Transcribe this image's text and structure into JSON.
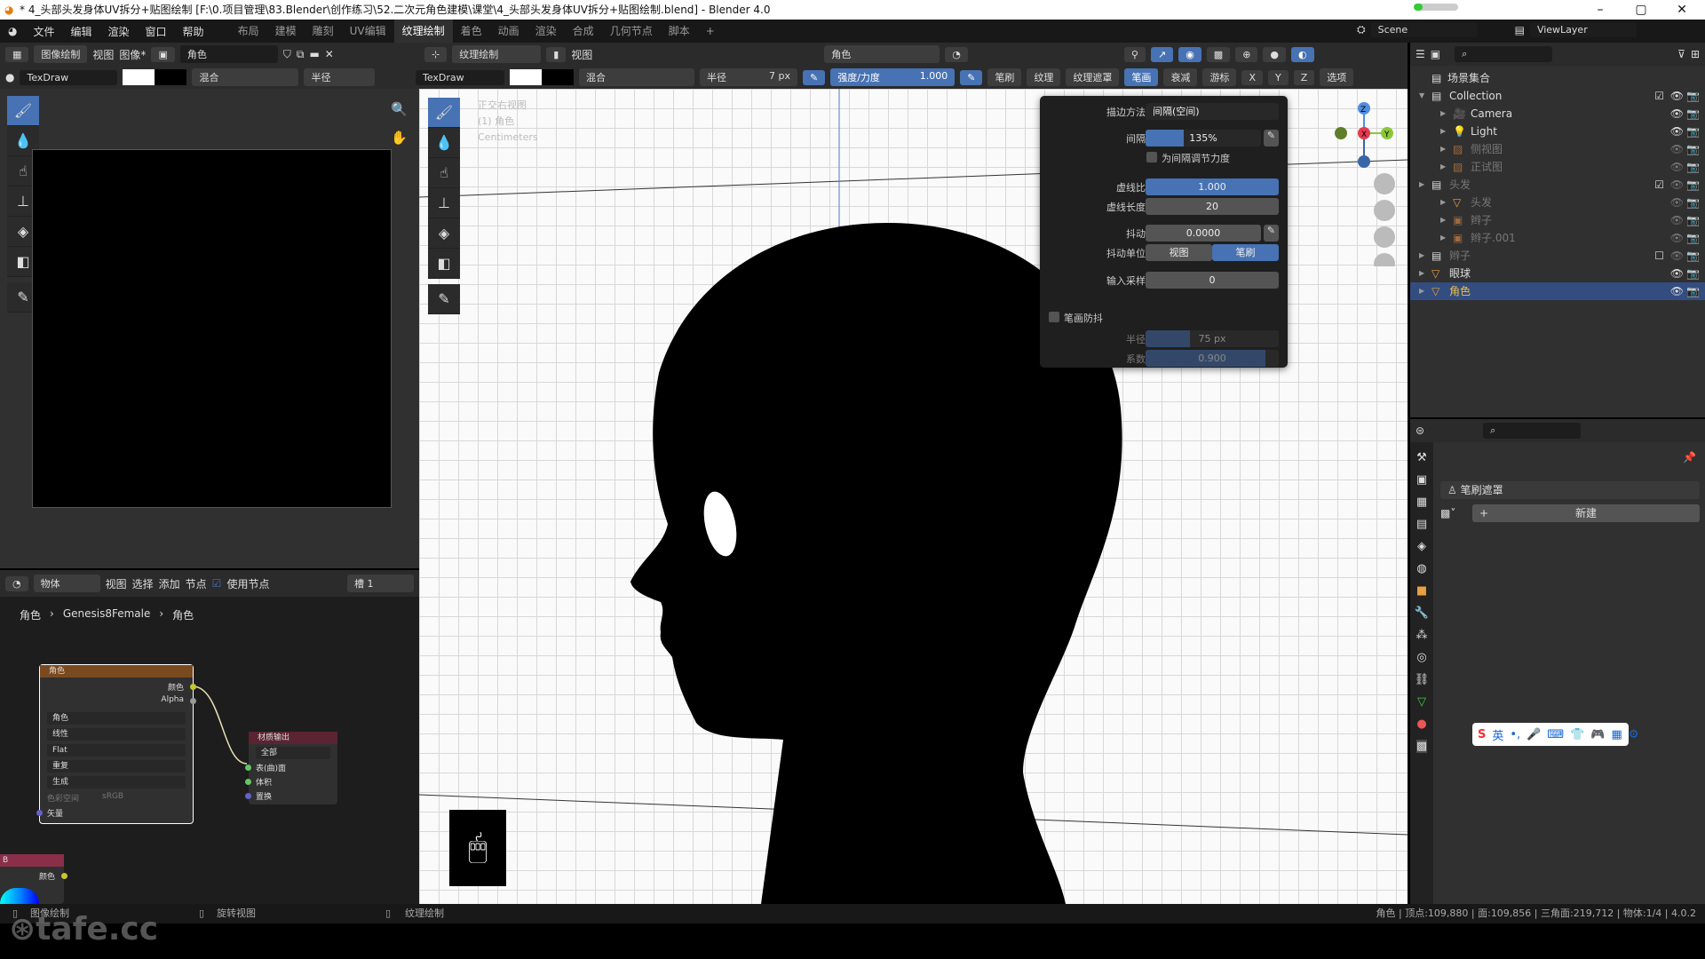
{
  "window": {
    "title": "* 4_头部头发身体UV拆分+贴图绘制 [F:\\0.项目管理\\83.Blender\\创作练习\\52.二次元角色建模\\课堂\\4_头部头发身体UV拆分+贴图绘制.blend] - Blender 4.0",
    "minimize": "–",
    "maximize": "▢",
    "close": "✕"
  },
  "menu": {
    "items": [
      "文件",
      "编辑",
      "渲染",
      "窗口",
      "帮助"
    ],
    "workspaces": [
      "布局",
      "建模",
      "雕刻",
      "UV编辑",
      "纹理绘制",
      "着色",
      "动画",
      "渲染",
      "合成",
      "几何节点",
      "脚本",
      "+"
    ],
    "active_workspace": "纹理绘制",
    "scene": "Scene",
    "view_layer": "ViewLayer"
  },
  "image_editor": {
    "mode": "图像绘制",
    "view": "视图",
    "image_menu": "图像*",
    "image_name": "角色",
    "brush": "TexDraw",
    "blend": "混合",
    "radius_label": "半径"
  },
  "viewport": {
    "mode": "纹理绘制",
    "view": "视图",
    "material": "角色",
    "brush": "TexDraw",
    "blend": "混合",
    "radius_label": "半径",
    "radius_value": "7 px",
    "strength_label": "强度/力度",
    "strength_value": "1.000",
    "menus": [
      "笔刷",
      "纹理",
      "纹理遮罩",
      "笔画",
      "衰减",
      "游标"
    ],
    "active_menu": "笔画",
    "axes": [
      "X",
      "Y",
      "Z"
    ],
    "options": "选项",
    "overlay": [
      "正交右视图",
      "(1) 角色",
      "Centimeters"
    ]
  },
  "stroke_popup": {
    "method_label": "描边方法",
    "method_value": "间隔(空间)",
    "spacing_label": "间隔",
    "spacing_value": "135%",
    "spacing_fill": 0.33,
    "spacing_pressure": "为间隔调节力度",
    "dash_ratio_label": "虚线比",
    "dash_ratio_value": "1.000",
    "dash_len_label": "虚线长度",
    "dash_len_value": "20",
    "jitter_label": "抖动",
    "jitter_value": "0.0000",
    "jitter_unit_label": "抖动单位",
    "jitter_unit_options": [
      "视图",
      "笔刷"
    ],
    "jitter_unit_selected": "笔刷",
    "input_samples_label": "输入采样",
    "input_samples_value": "0",
    "stabilize_label": "笔画防抖",
    "stab_radius_label": "半径",
    "stab_radius_value": "75 px",
    "stab_factor_label": "系数",
    "stab_factor_value": "0.900",
    "stab_factor_fill": 0.9
  },
  "node_editor": {
    "type": "物体",
    "menus": [
      "视图",
      "选择",
      "添加",
      "节点"
    ],
    "use_nodes": "使用节点",
    "slot": "槽 1",
    "breadcrumb": [
      "角色",
      "Genesis8Female",
      "角色"
    ],
    "image_node": {
      "title": "角色",
      "out_color": "颜色",
      "out_alpha": "Alpha",
      "image": "角色",
      "interp": "线性",
      "proj": "Flat",
      "ext": "重复",
      "source": "生成",
      "colorspace_label": "色彩空间",
      "colorspace": "sRGB",
      "in_vector": "矢量"
    },
    "output_node": {
      "title": "材质输出",
      "target": "全部",
      "inputs": [
        "表(曲)面",
        "体积",
        "置换"
      ]
    },
    "partial_node": {
      "title": "B",
      "out_color": "颜色"
    }
  },
  "outliner": {
    "root": "场景集合",
    "items": [
      {
        "name": "Collection",
        "depth": 1,
        "type": "collection",
        "expanded": true,
        "check": true
      },
      {
        "name": "Camera",
        "depth": 2,
        "type": "camera"
      },
      {
        "name": "Light",
        "depth": 2,
        "type": "light"
      },
      {
        "name": "侧视图",
        "depth": 2,
        "type": "image",
        "dim": true
      },
      {
        "name": "正试图",
        "depth": 2,
        "type": "image",
        "dim": true
      },
      {
        "name": "头发",
        "depth": 1,
        "type": "collection",
        "dim": true,
        "check": true
      },
      {
        "name": "头发",
        "depth": 2,
        "type": "mesh",
        "dim": true
      },
      {
        "name": "辫子",
        "depth": 2,
        "type": "empty",
        "dim": true
      },
      {
        "name": "辫子.001",
        "depth": 2,
        "type": "empty",
        "dim": true
      },
      {
        "name": "辫子",
        "depth": 1,
        "type": "collection",
        "dim": true,
        "check": false
      },
      {
        "name": "眼球",
        "depth": 1,
        "type": "mesh"
      },
      {
        "name": "角色",
        "depth": 1,
        "type": "mesh",
        "selected": true
      }
    ]
  },
  "properties": {
    "panel": "笔刷遮罩",
    "new_button": "新建"
  },
  "ime": {
    "lang": "英"
  },
  "status": {
    "left": "图像绘制",
    "middle": "旋转视图",
    "right_tool": "纹理绘制",
    "stats": "角色 | 顶点:109,880 | 面:109,856 | 三角面:219,712 | 物体:1/4 | 4.0.2"
  },
  "watermark": "tafe.cc",
  "colors": {
    "accent": "#4772b3",
    "panel": "#303030",
    "header": "#2b2b2b",
    "node_image": "#7a4a1f",
    "node_output": "#5a2432",
    "selected_row": "#334d80"
  }
}
